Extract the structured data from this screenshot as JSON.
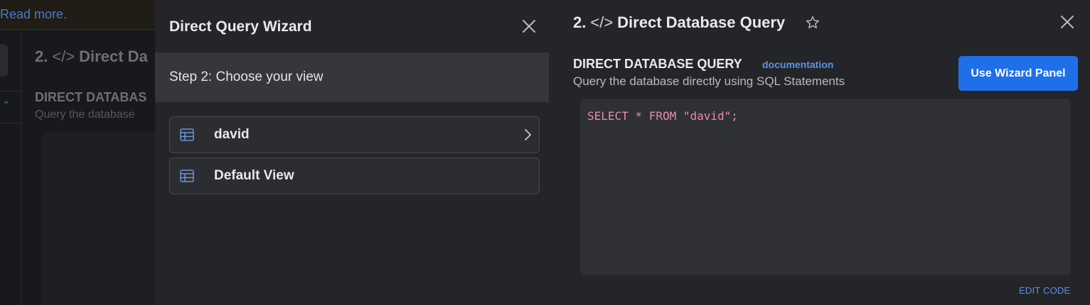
{
  "background": {
    "banner_link": "Read more.",
    "title_number": "2.",
    "title_icon": "</>",
    "title_text": "Direct Da",
    "heading": "DIRECT DATABAS",
    "subtitle": "Query the database"
  },
  "wizard": {
    "title": "Direct Query Wizard",
    "step_label": "Step 2: Choose your view",
    "views": [
      {
        "label": "david",
        "icon": "table-icon",
        "has_chevron": true
      },
      {
        "label": "Default View",
        "icon": "table-icon",
        "has_chevron": false
      }
    ]
  },
  "query_panel": {
    "title_number": "2.",
    "title_icon": "</>",
    "title_text": "Direct Database Query",
    "heading": "DIRECT DATABASE QUERY",
    "documentation_link": "documentation",
    "subtitle": "Query the database directly using SQL Statements",
    "wizard_button": "Use Wizard Panel",
    "sql": "SELECT * FROM \"david\";",
    "edit_code_link": "EDIT CODE"
  },
  "colors": {
    "accent": "#1f6fe8",
    "link": "#5b93e6",
    "sql_text": "#e889b5",
    "panel_bg": "#232529",
    "step_bg": "#35373c"
  }
}
